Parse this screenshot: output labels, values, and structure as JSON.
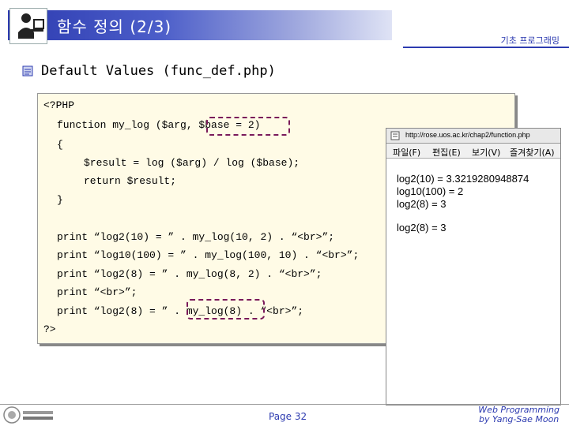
{
  "header": {
    "title": "함수 정의 (2/3)",
    "subtitle": "기초 프로그래밍"
  },
  "slide": {
    "heading": "Default Values (func_def.php)"
  },
  "code": {
    "lines": [
      "<?PHP",
      "function my_log ($arg, $base = 2)",
      "{",
      "$result = log ($arg) / log ($base);",
      "return $result;",
      "}",
      "print “log2(10) = ” . my_log(10, 2) . “<br>”;",
      "print “log10(100) = ” . my_log(100, 10) . “<br>”;",
      "print “log2(8) = ” . my_log(8, 2) . “<br>”;",
      "print “<br>”;",
      "print “log2(8) = ” . my_log(8) . “<br>”;",
      "?>"
    ]
  },
  "browser": {
    "url": "http://rose.uos.ac.kr/chap2/function.php",
    "menu": [
      "파일(F)",
      "편집(E)",
      "보기(V)",
      "즐겨찾기(A)"
    ],
    "output": [
      "log2(10) = 3.3219280948874",
      "log10(100) = 2",
      "log2(8) = 3",
      "log2(8) = 3"
    ]
  },
  "footer": {
    "page": "Page 32",
    "right_line1": "Web Programming",
    "right_line2": "by Yang-Sae Moon"
  }
}
